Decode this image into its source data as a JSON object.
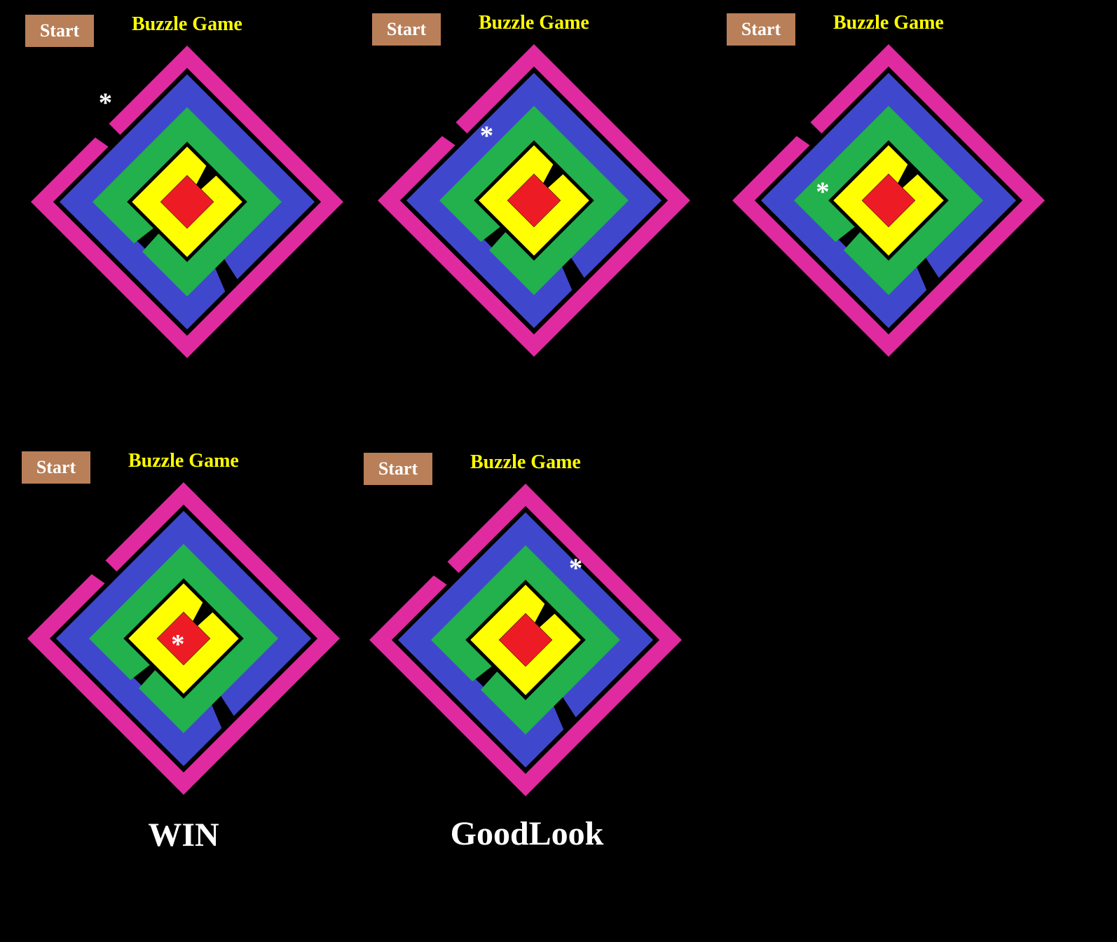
{
  "colors": {
    "background": "#000000",
    "start_button": "#b97f58",
    "title": "#ffff00",
    "ring_outer": "#e02aa0",
    "ring_blue": "#3f48cc",
    "ring_green": "#22b14c",
    "ring_yellow": "#ffff00",
    "center": "#ed1c24",
    "marker": "#ffffff"
  },
  "panels": [
    {
      "start_label": "Start",
      "title": "Buzzle Game",
      "marker": "*",
      "message": ""
    },
    {
      "start_label": "Start",
      "title": "Buzzle Game",
      "marker": "*",
      "message": ""
    },
    {
      "start_label": "Start",
      "title": "Buzzle Game",
      "marker": "*",
      "message": ""
    },
    {
      "start_label": "Start",
      "title": "Buzzle Game",
      "marker": "*",
      "message": "WIN"
    },
    {
      "start_label": "Start",
      "title": "Buzzle Game",
      "marker": "*",
      "message": "GoodLook"
    }
  ]
}
